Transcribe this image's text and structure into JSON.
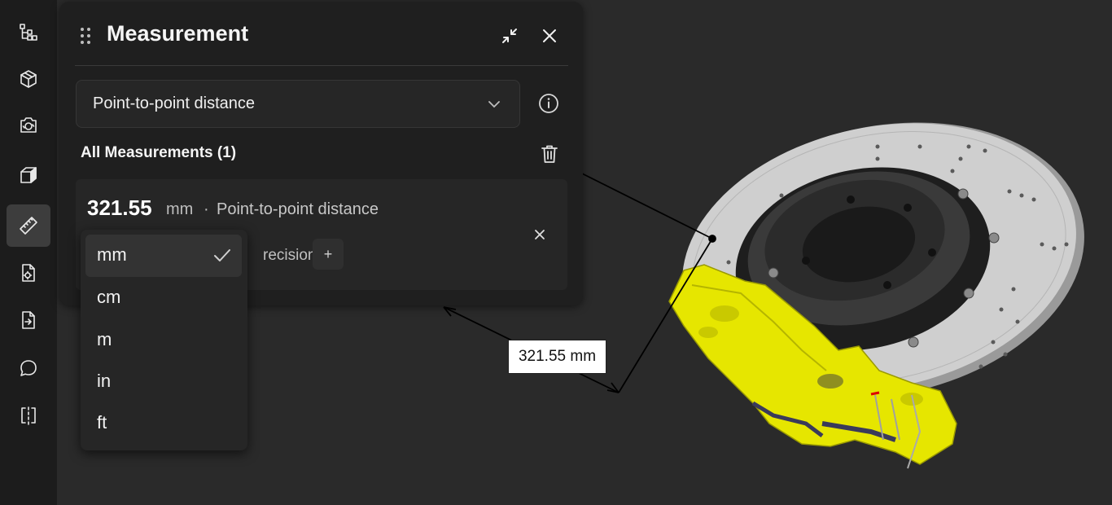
{
  "toolbar": {
    "items": [
      {
        "icon": "model-tree-icon",
        "active": false
      },
      {
        "icon": "parts-cube-icon",
        "active": false
      },
      {
        "icon": "camera-views-icon",
        "active": false
      },
      {
        "icon": "solid-box-icon",
        "active": false
      },
      {
        "icon": "ruler-icon",
        "active": true
      },
      {
        "icon": "document-settings-icon",
        "active": false
      },
      {
        "icon": "export-document-icon",
        "active": false
      },
      {
        "icon": "comment-icon",
        "active": false
      },
      {
        "icon": "section-split-icon",
        "active": false
      }
    ]
  },
  "panel": {
    "title": "Measurement",
    "mode_select": {
      "value": "Point-to-point distance"
    },
    "section_title": "All Measurements (1)",
    "measurement": {
      "value": "321.55",
      "unit": "mm",
      "separator": "·",
      "type": "Point-to-point distance",
      "precision_label": "recision",
      "precision_plus": "+"
    }
  },
  "unit_dropdown": {
    "options": [
      {
        "label": "mm",
        "selected": true
      },
      {
        "label": "cm",
        "selected": false
      },
      {
        "label": "m",
        "selected": false
      },
      {
        "label": "in",
        "selected": false
      },
      {
        "label": "ft",
        "selected": false
      }
    ]
  },
  "viewport": {
    "dimension_label": "321.55 mm"
  },
  "colors": {
    "caliper": "#e6e600",
    "disc": "#c9c9c9",
    "hub": "#2e2e2e",
    "background": "#2a2a2a"
  }
}
